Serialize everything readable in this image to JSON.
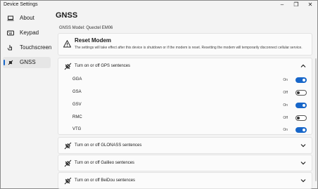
{
  "window": {
    "title": "Device Settings",
    "controls": [
      "–",
      "❐",
      "✕"
    ]
  },
  "sidebar": {
    "items": [
      {
        "label": "About",
        "icon": "laptop-icon",
        "active": false
      },
      {
        "label": "Keypad",
        "icon": "keyboard-icon",
        "active": false
      },
      {
        "label": "Touchscreen",
        "icon": "touch-hand-icon",
        "active": false
      },
      {
        "label": "GNSS",
        "icon": "gnss-icon",
        "active": true
      }
    ]
  },
  "page": {
    "title": "GNSS",
    "model": "GNSS Model: Quectel EM06"
  },
  "reset": {
    "title": "Reset Modem",
    "description": "The settings will take effect after this device is shutdown or if the modem is reset. Resetting the modem will temporarily disconnect cellular service."
  },
  "gps": {
    "label": "Turn on or off GPS sentences",
    "expanded": true,
    "sentences": [
      {
        "name": "GGA",
        "state": "On",
        "on": true
      },
      {
        "name": "GSA",
        "state": "Off",
        "on": false
      },
      {
        "name": "GSV",
        "state": "On",
        "on": true
      },
      {
        "name": "RMC",
        "state": "Off",
        "on": false
      },
      {
        "name": "VTG",
        "state": "On",
        "on": true
      }
    ]
  },
  "collapsed_sections": [
    {
      "label": "Turn on or off GLONASS sentences"
    },
    {
      "label": "Turn on or off Galileo sentences"
    },
    {
      "label": "Turn on or off BeiDou sentences"
    }
  ],
  "colors": {
    "accent": "#1766c9"
  }
}
